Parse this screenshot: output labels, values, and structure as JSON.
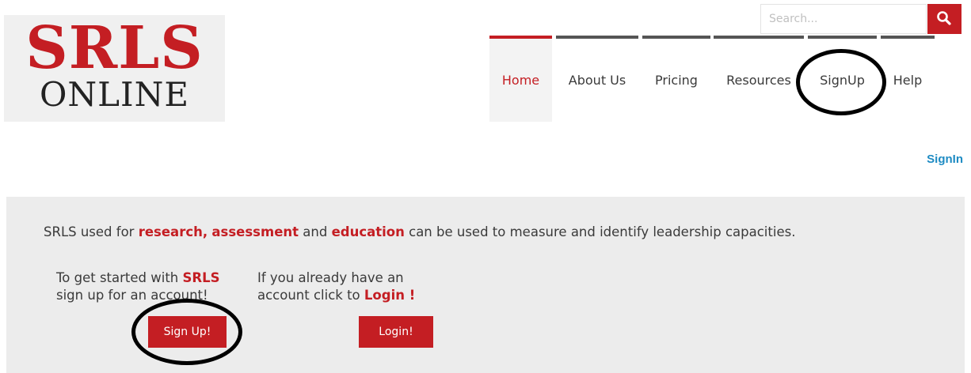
{
  "logo": {
    "line1": "SRLS",
    "line2": "ONLINE"
  },
  "search": {
    "placeholder": "Search...",
    "icon": "search-icon"
  },
  "nav": [
    {
      "label": "Home",
      "active": true
    },
    {
      "label": "About Us",
      "active": false
    },
    {
      "label": "Pricing",
      "active": false
    },
    {
      "label": "Resources",
      "active": false
    },
    {
      "label": "SignUp",
      "active": false
    },
    {
      "label": "Help",
      "active": false
    }
  ],
  "signin": "SignIn",
  "intro": {
    "p1": "SRLS used for ",
    "h1": "research,",
    "p2": " ",
    "h2": "assessment",
    "p3": " and ",
    "h3": "education",
    "p4": " can be used to measure and identify leadership capacities."
  },
  "signup_col": {
    "t1": "To get started with ",
    "h": "SRLS",
    "t2": "sign up for an account!",
    "button": "Sign Up!"
  },
  "login_col": {
    "t1": "If you already have an",
    "t2": "account click to ",
    "h": "Login !",
    "button": "Login!"
  },
  "colors": {
    "brand_red": "#c41e23",
    "link_blue": "#1e8bc3",
    "panel_bg": "#ececec",
    "nav_bar": "#555555"
  }
}
